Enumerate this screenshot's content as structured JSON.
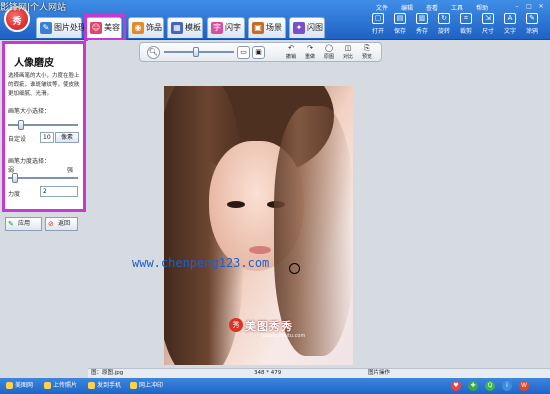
{
  "watermark": {
    "top_title": "影锋网|个人网站",
    "site_url": "www.chenpeng123.com",
    "photo_brand": "美图秀秀",
    "photo_brand_url": "xiuxiu.meitu.com",
    "photo_logo": "秀"
  },
  "app": {
    "logo_char": "秀"
  },
  "tabs": [
    {
      "label": "图片处理",
      "icon": "picture-edit-icon",
      "active": false
    },
    {
      "label": "美容",
      "icon": "beauty-icon",
      "active": true
    },
    {
      "label": "饰品",
      "icon": "accessory-icon",
      "active": false
    },
    {
      "label": "模板",
      "icon": "template-icon",
      "active": false
    },
    {
      "label": "闪字",
      "icon": "flash-text-icon",
      "active": false
    },
    {
      "label": "场景",
      "icon": "scene-icon",
      "active": false
    },
    {
      "label": "闪图",
      "icon": "flash-image-icon",
      "active": false
    }
  ],
  "menu": [
    "文件",
    "编辑",
    "查看",
    "工具",
    "帮助"
  ],
  "toolbar": [
    {
      "label": "打开",
      "icon": "open-icon"
    },
    {
      "label": "保存",
      "icon": "save-icon"
    },
    {
      "label": "秀存",
      "icon": "xiu-save-icon"
    },
    {
      "label": "旋转",
      "icon": "rotate-icon"
    },
    {
      "label": "裁剪",
      "icon": "crop-icon"
    },
    {
      "label": "尺寸",
      "icon": "resize-icon"
    },
    {
      "label": "文字",
      "icon": "text-icon"
    },
    {
      "label": "涂鸦",
      "icon": "doodle-icon"
    }
  ],
  "panel": {
    "title": "人像磨皮",
    "description": "选择画笔的大小，力度在脸上的瑕疵，谁斑皱纹等，使皮肤更加细腻、光滑。",
    "brush_size_label": "画笔大小选择：",
    "custom_label": "自定设",
    "brush_size_value": "10",
    "brush_size_unit": "像素",
    "brush_size_level": 0.15,
    "force_label": "画笔力度选择：",
    "weak_label": "弱",
    "strong_label": "强",
    "force_value_label": "力度",
    "force_value": "2",
    "force_level": 0.05,
    "apply_button": "应用",
    "back_button": "返回"
  },
  "view": {
    "zoom_level": 0.45,
    "buttons": [
      {
        "label": "撤销",
        "icon": "undo-icon"
      },
      {
        "label": "重做",
        "icon": "redo-icon"
      },
      {
        "label": "原图",
        "icon": "original-icon"
      },
      {
        "label": "对比",
        "icon": "compare-icon"
      },
      {
        "label": "预览",
        "icon": "preview-icon"
      }
    ]
  },
  "status": {
    "file": "图：原图.jpg",
    "size": "348 * 479",
    "mode": "图片操作"
  },
  "bottom": {
    "links": [
      "美图网",
      "上传照片",
      "发到手机",
      "网上冲印"
    ]
  }
}
